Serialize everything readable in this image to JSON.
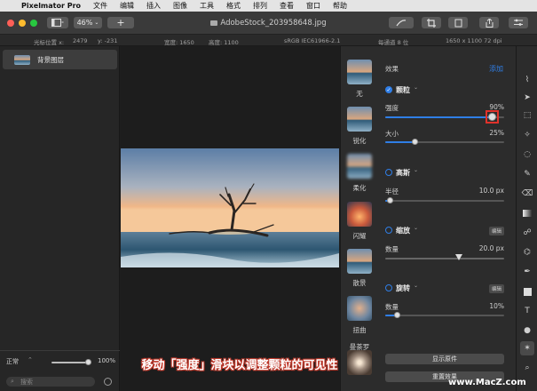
{
  "menubar": {
    "app": "Pixelmator Pro",
    "items": [
      "文件",
      "编辑",
      "插入",
      "图像",
      "工具",
      "格式",
      "排列",
      "查看",
      "窗口",
      "帮助"
    ]
  },
  "titlebar": {
    "zoom": "46%",
    "document_title": "AdobeStock_203958648.jpg"
  },
  "infobar": {
    "cursor_label": "光标位置 x:",
    "cursor_x": "2479",
    "cursor_y": "y: -231",
    "width": "宽度: 1650",
    "height": "高度: 1100",
    "colorspace": "sRGB IEC61966-2.1",
    "depth": "每通道 8 位",
    "size": "1650 x 1100 72 dpi"
  },
  "layers": {
    "items": [
      {
        "name": "背景图层"
      }
    ],
    "blend_mode": "正常",
    "opacity": "100%",
    "search_placeholder": "搜索"
  },
  "effects_browser": [
    {
      "label": "无"
    },
    {
      "label": "锐化"
    },
    {
      "label": "柔化"
    },
    {
      "label": "闪耀"
    },
    {
      "label": "散景"
    },
    {
      "label": "扭曲"
    },
    {
      "label": "曼荼罗"
    }
  ],
  "settings": {
    "effects_title": "效果",
    "add_label": "添加",
    "grain": {
      "name": "颗粒",
      "strength_label": "强度",
      "strength_value": "90%",
      "strength_fraction": 0.9,
      "size_label": "大小",
      "size_value": "25%",
      "size_fraction": 0.25
    },
    "gaussian": {
      "name": "高斯",
      "radius_label": "半径",
      "radius_value": "10.0 px",
      "radius_fraction": 0.04
    },
    "zoom": {
      "name": "缩放",
      "edit_label": "编辑",
      "amount_label": "数量",
      "amount_value": "20.0 px",
      "amount_fraction": 0.62
    },
    "spin": {
      "name": "旋转",
      "edit_label": "编辑",
      "amount_label": "数量",
      "amount_value": "10%",
      "amount_fraction": 0.1
    },
    "show_original": "显示原件",
    "reset_effects": "重置效果"
  },
  "caption": "移动「强度」滑块以调整颗粒的可见性",
  "watermark": "www.MacZ.com",
  "colors": {
    "accent": "#2f7ee6",
    "highlight_box": "#e0322b"
  }
}
